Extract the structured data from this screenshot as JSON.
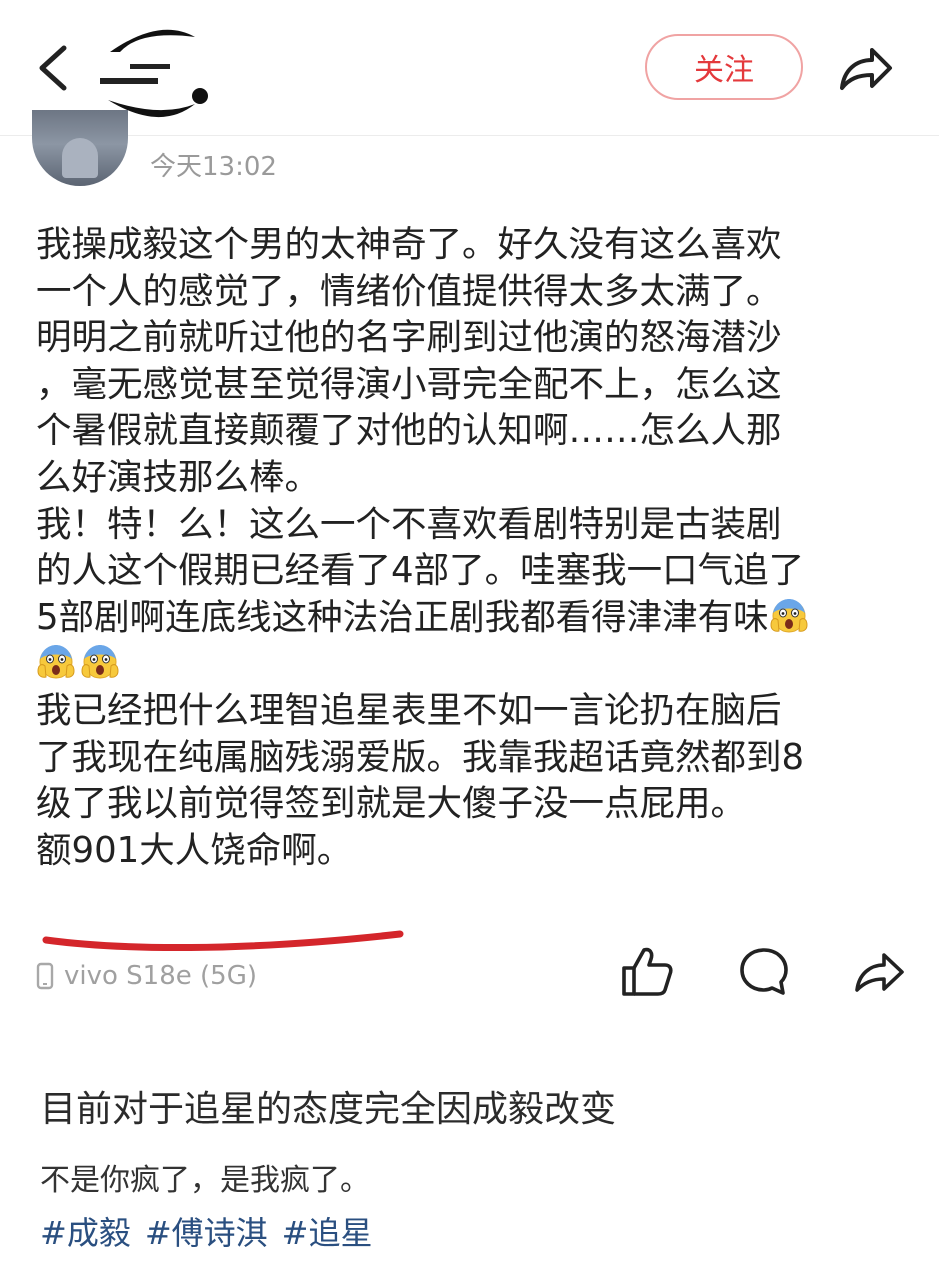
{
  "header": {
    "follow_label": "关注"
  },
  "post": {
    "time": "今天13:02",
    "lines": [
      "我操成毅这个男的太神奇了。好久没有这么喜欢",
      "一个人的感觉了，情绪价值提供得太多太满了。",
      "明明之前就听过他的名字刷到过他演的怒海潜沙",
      "，毫无感觉甚至觉得演小哥完全配不上，怎么这",
      "个暑假就直接颠覆了对他的认知啊……怎么人那",
      "么好演技那么棒。",
      "我！特！么！这么一个不喜欢看剧特别是古装剧",
      "的人这个假期已经看了4部了。哇塞我一口气追了",
      "5部剧啊连底线这种法治正剧我都看得津津有味"
    ],
    "lines_after_emoji": [
      "我已经把什么理智追星表里不如一言论扔在脑后",
      "了我现在纯属脑残溺爱版。我靠我超话竟然都到8",
      "级了我以前觉得签到就是大傻子没一点屁用。",
      "额901大人饶命啊。"
    ],
    "emoji_name": "face-screaming-in-fear",
    "underline_color": "#d4262b"
  },
  "meta": {
    "device": "vivo S18e (5G)"
  },
  "topic": {
    "title": "目前对于追星的态度完全因成毅改变",
    "desc": "不是你疯了，是我疯了。",
    "tags": [
      "#成毅",
      "#傅诗淇",
      "#追星"
    ]
  }
}
